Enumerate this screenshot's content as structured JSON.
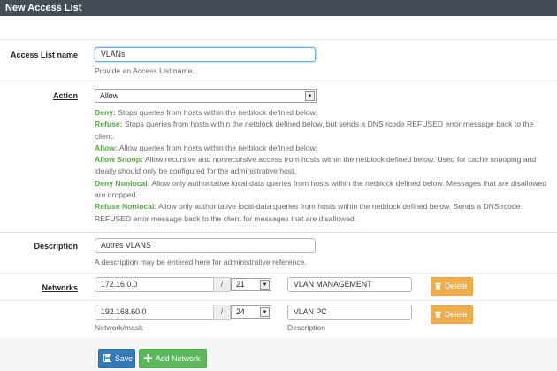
{
  "window": {
    "title": "New Access List"
  },
  "name_field": {
    "label": "Access List name",
    "value": "VLANs",
    "help": "Provide an Access List name."
  },
  "action_field": {
    "label": "Action",
    "selected": "Allow",
    "help": [
      {
        "term": "Deny:",
        "text": " Stops queries from hosts within the netblock defined below."
      },
      {
        "term": "Refuse:",
        "text": " Stops queries from hosts within the netblock defined below, but sends a DNS rcode REFUSED error message back to the client."
      },
      {
        "term": "Allow:",
        "text": " Allow queries from hosts within the netblock defined below."
      },
      {
        "term": "Allow Snoop:",
        "text": " Allow recursive and nonrecursive access from hosts within the netblock defined below. Used for cache snooping and ideally should only be configured for the administrative host."
      },
      {
        "term": "Deny Nonlocal:",
        "text": " Allow only authoritative local-data queries from hosts within the netblock defined below. Messages that are disallowed are dropped."
      },
      {
        "term": "Refuse Nonlocal:",
        "text": " Allow only authoritative local-data queries from hosts within the netblock defined below. Sends a DNS rcode REFUSED error message back to the client for messages that are disallowed."
      }
    ]
  },
  "description_field": {
    "label": "Description",
    "value": "Autres VLANS",
    "help": "A description may be entered here for administrative reference."
  },
  "networks": {
    "label": "Networks",
    "separator": "/",
    "delete_label": "Delete",
    "rows": [
      {
        "network": "172.16.0.0",
        "mask": "21",
        "description": "VLAN MANAGEMENT"
      },
      {
        "network": "192.168.60.0",
        "mask": "24",
        "description": "VLAN PC"
      }
    ],
    "network_help": "Network/mask",
    "description_help": "Description"
  },
  "buttons": {
    "save": "Save",
    "add_network": "Add Network"
  },
  "colors": {
    "titlebar": "#444c55",
    "help_term": "#53a840",
    "delete": "#f0ad4e",
    "save": "#337ab7",
    "add": "#5cb85c"
  }
}
